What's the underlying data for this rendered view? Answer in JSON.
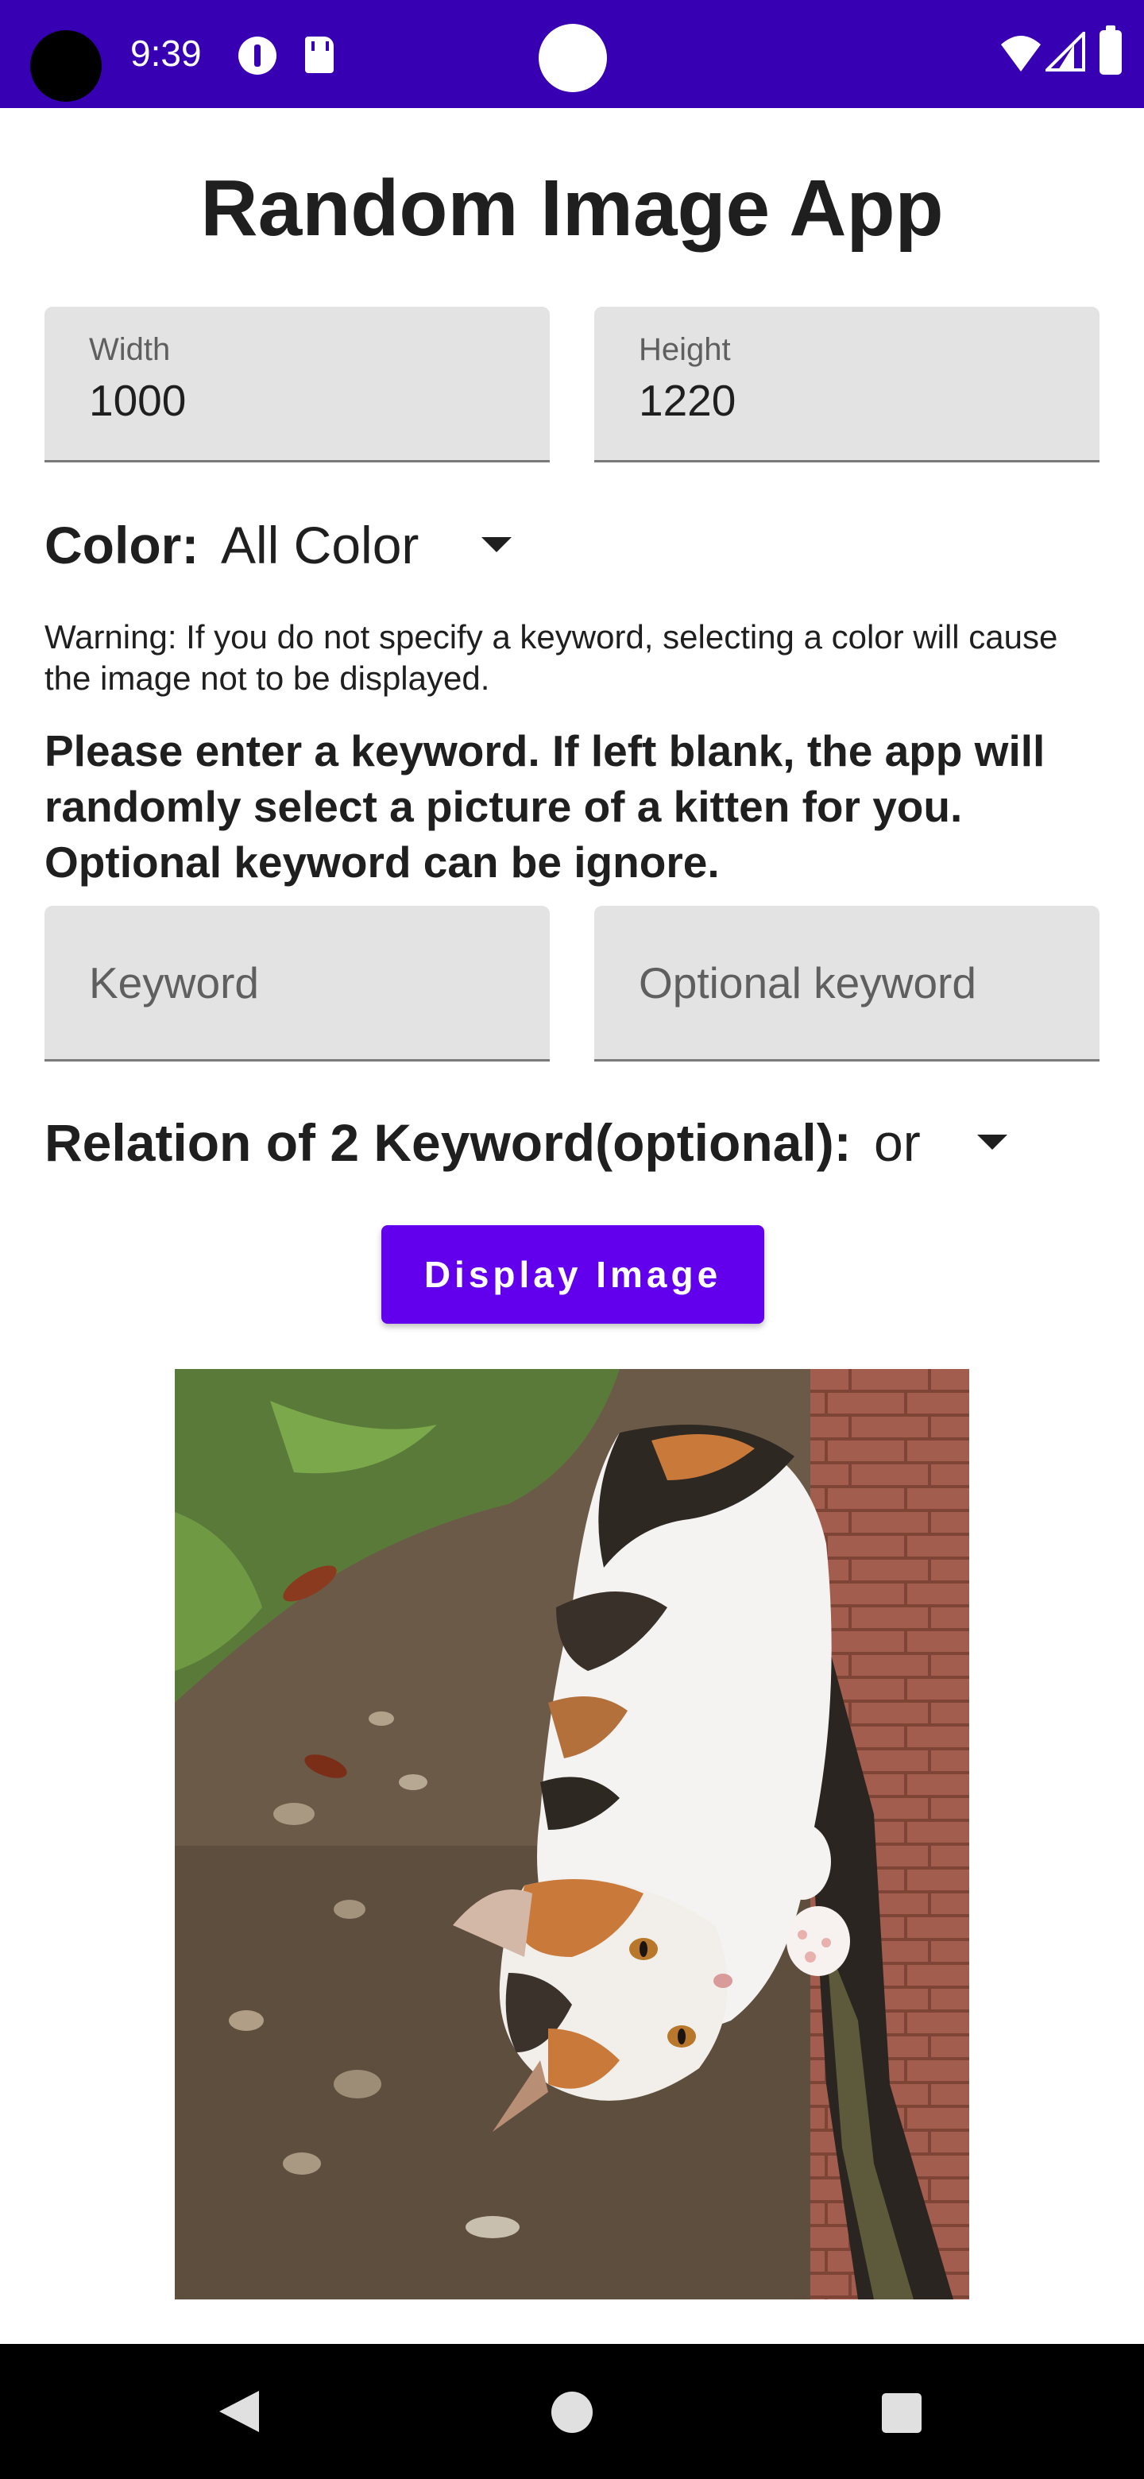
{
  "status_bar": {
    "time": "9:39",
    "icons": [
      "camera-cutout",
      "data-saver-icon",
      "sd-card-icon",
      "wifi-icon",
      "signal-icon",
      "battery-icon"
    ],
    "background_color": "#3700b3"
  },
  "app": {
    "title": "Random Image App"
  },
  "width_field": {
    "label": "Width",
    "value": "1000"
  },
  "height_field": {
    "label": "Height",
    "value": "1220"
  },
  "color": {
    "label": "Color:",
    "selected": "All Color"
  },
  "warning": "Warning: If you do not specify a keyword, selecting a color will cause the image not to be displayed.",
  "instruction": "Please enter a keyword. If left blank, the app will randomly select a picture of a kitten for you. Optional keyword can be ignore.",
  "keyword_field": {
    "placeholder": "Keyword",
    "value": ""
  },
  "optional_keyword_field": {
    "placeholder": "Optional keyword",
    "value": ""
  },
  "relation": {
    "label": "Relation of 2 Keyword(optional):",
    "selected": "or"
  },
  "display_button": {
    "label": "Display Image",
    "color": "#6200ee"
  },
  "result_image": {
    "subject": "calico kitten lying on its side on dirt beside a brick wall"
  },
  "nav_bar": {
    "icons": [
      "back-icon",
      "home-icon",
      "recents-icon"
    ]
  }
}
